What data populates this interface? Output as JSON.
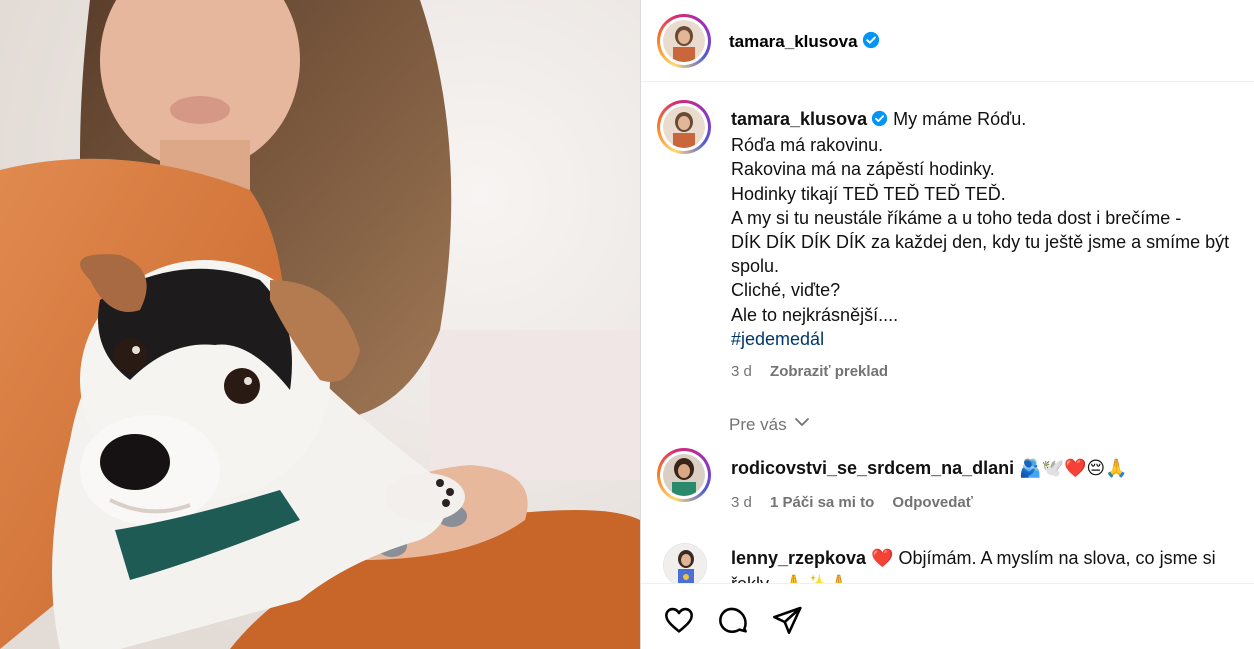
{
  "post": {
    "author": "tamara_klusova",
    "photo_alt": "photo-dog-and-woman",
    "caption": {
      "first_line": "My máme Róďu.",
      "lines": [
        "Róďa má rakovinu.",
        "Rakovina má na zápěstí hodinky.",
        "Hodinky tikají TEĎ TEĎ TEĎ TEĎ.",
        "A my si tu neustále říkáme a u toho teda dost i brečíme -",
        "DÍK DÍK DÍK DÍK za každej den, kdy tu ještě jsme a smíme být",
        "spolu.",
        "Cliché, viďte?",
        "Ale to nejkrásnější...."
      ],
      "hashtag": "#jedemedál",
      "age": "3 d",
      "translate": "Zobraziť preklad"
    }
  },
  "for_you_label": "Pre vás",
  "comments": [
    {
      "username": "rodicovstvi_se_srdcem_na_dlani",
      "text": "🫂🕊️❤️😔🙏",
      "age": "3 d",
      "likes": "1 Páči sa mi to",
      "reply": "Odpovedať"
    },
    {
      "username": "lenny_rzepkova",
      "text": "❤️ Objímám. A myslím na slova, co jsme si",
      "text2": "řekly...🙏✨🙏"
    }
  ],
  "colors": {
    "verified": "#0095f6",
    "muted": "#737373",
    "hashtag": "#00376b"
  },
  "icons": [
    "verified-badge-icon",
    "chevron-down-icon",
    "heart-icon",
    "comment-icon",
    "share-icon"
  ]
}
